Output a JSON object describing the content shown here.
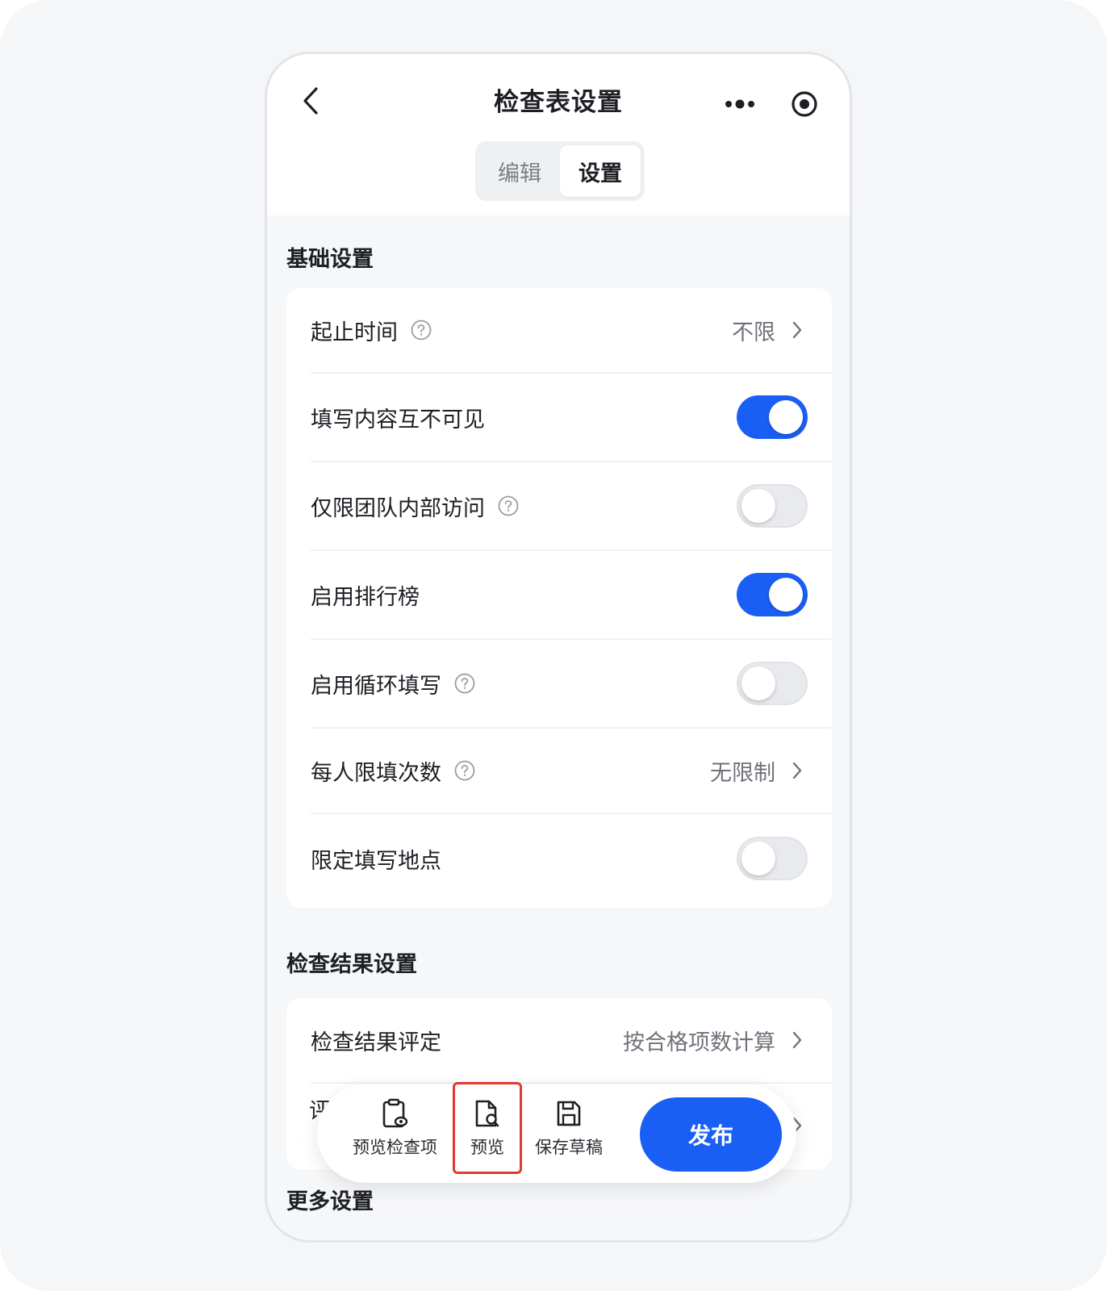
{
  "nav": {
    "title": "检查表设置",
    "back_icon": "chevron-left-icon",
    "more_icon": "more-dots-icon",
    "close_icon": "target-circle-icon"
  },
  "tabs": [
    {
      "label": "编辑",
      "active": false
    },
    {
      "label": "设置",
      "active": true
    }
  ],
  "basic": {
    "title": "基础设置",
    "rows": [
      {
        "label": "起止时间",
        "help": true,
        "value": "不限",
        "chevron": true
      },
      {
        "label": "填写内容互不可见",
        "toggle": "on"
      },
      {
        "label": "仅限团队内部访问",
        "help": true,
        "toggle": "off"
      },
      {
        "label": "启用排行榜",
        "toggle": "on"
      },
      {
        "label": "启用循环填写",
        "help": true,
        "toggle": "off"
      },
      {
        "label": "每人限填次数",
        "help": true,
        "value": "无限制",
        "chevron": true
      },
      {
        "label": "限定填写地点",
        "toggle": "off"
      }
    ]
  },
  "result": {
    "title": "检查结果设置",
    "rows": [
      {
        "label": "检查结果评定",
        "value": "按合格项数计算",
        "chevron": true
      },
      {
        "label": "评",
        "chevron": true
      }
    ]
  },
  "more": {
    "title": "更多设置"
  },
  "bottom_bar": {
    "preview_items_label": "预览检查项",
    "preview_label": "预览",
    "save_draft_label": "保存草稿",
    "publish_label": "发布"
  },
  "colors": {
    "accent": "#1a5ff5",
    "highlight": "#e03a2f"
  }
}
